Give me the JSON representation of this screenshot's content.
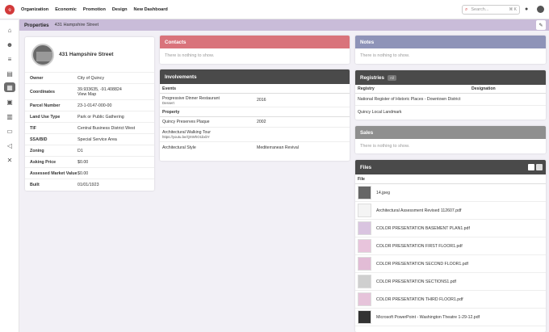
{
  "nav": {
    "items": [
      "Organization",
      "Economic",
      "Promotion",
      "Design",
      "New Dashboard"
    ],
    "search_placeholder": "Search...",
    "shortcut": "⌘ K"
  },
  "page": {
    "title": "Properties",
    "breadcrumb": "431 Hampshire Street"
  },
  "property": {
    "name": "431 Hampshire Street",
    "owner_label": "Owner",
    "owner": "City of Quincy",
    "coords_label": "Coordinates",
    "coords": "39.933635, -91.408824",
    "view_map": "View Map",
    "parcel_label": "Parcel Number",
    "parcel": "23-1-0147-000-00",
    "landuse_label": "Land Use Type",
    "landuse": "Park or Public Gathering",
    "tif_label": "TIF",
    "tif": "Central Business District West",
    "ssa_label": "SSA/BID",
    "ssa": "Special Service Area",
    "zoning_label": "Zoning",
    "zoning": "D1",
    "asking_label": "Asking Price",
    "asking": "$0.00",
    "assessed_label": "Assessed Market Value",
    "assessed": "$0.00",
    "built_label": "Built",
    "built": "01/01/1923"
  },
  "contacts": {
    "title": "Contacts",
    "empty": "There is nothing to show."
  },
  "notes": {
    "title": "Notes",
    "empty": "There is nothing to show."
  },
  "involvements": {
    "title": "Involvements",
    "events_header": "Events",
    "events": [
      {
        "name": "Progressive Dinner Restaurant",
        "sub": "Dessert",
        "year": "2016"
      }
    ],
    "property_header": "Property",
    "properties": [
      {
        "name": "Quincy Preserves Plaque",
        "sub": "",
        "value": "2002"
      },
      {
        "name": "Architectural Walking Tour",
        "sub": "https://youtu.be/QXWhO1bxbY",
        "value": ""
      },
      {
        "name": "Architectural Style",
        "sub": "",
        "value": "Mediterranean Revival"
      }
    ]
  },
  "registries": {
    "title": "Registries",
    "badge": "All",
    "col_registry": "Registry",
    "col_designation": "Designation",
    "rows": [
      "National Register of Historic Places - Downtown District",
      "Quincy Local Landmark"
    ]
  },
  "sales": {
    "title": "Sales",
    "empty": "There is nothing to show."
  },
  "files": {
    "title": "Files",
    "col": "File",
    "items": [
      "14.jpeg",
      "Architectural Assessment Revised 112607.pdf",
      "COLOR PRESENTATION BASEMENT PLAN1.pdf",
      "COLOR PRESENTATION FIRST FLOOR1.pdf",
      "COLOR PRESENTATION SECOND FLOOR1.pdf",
      "COLOR PRESENTATION SECTIONS1.pdf",
      "COLOR PRESENTATION THIRD FLOOR1.pdf",
      "Microsoft PowerPoint - Washington Theatre 1-29-12.pdf"
    ]
  },
  "colors": {
    "contacts_head": "#d9737b",
    "notes_head": "#8e93b8",
    "dark_head": "#4a4a4a",
    "sales_head": "#8f8f8f"
  }
}
